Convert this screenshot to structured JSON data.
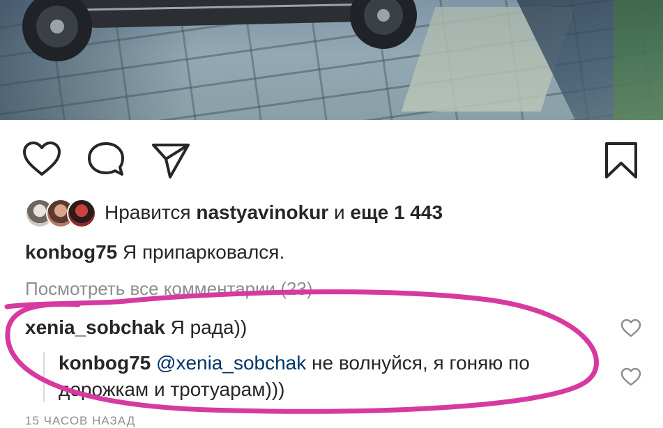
{
  "post": {
    "photo_label": "scooter-photo",
    "likes": {
      "prefix": "Нравится",
      "user": "nastyavinokur",
      "middle": "и",
      "rest": "еще 1 443"
    },
    "caption": {
      "user": "konbog75",
      "text": "Я припарковался."
    },
    "view_all": "Посмотреть все комментарии (23)",
    "comments": [
      {
        "user": "xenia_sobchak",
        "text": "Я рада))"
      }
    ],
    "reply": {
      "user": "konbog75",
      "mention": "@xenia_sobchak",
      "text": "не волнуйся, я гоняю по дорожкам и тротуарам)))"
    },
    "time": "15 ЧАСОВ НАЗАД"
  },
  "icons": {
    "like": "heart-icon",
    "comment": "comment-icon",
    "share": "share-icon",
    "save": "bookmark-icon"
  },
  "colors": {
    "text": "#262626",
    "muted": "#8e8e8e",
    "mention": "#003569",
    "marker": "#d63aa0"
  }
}
